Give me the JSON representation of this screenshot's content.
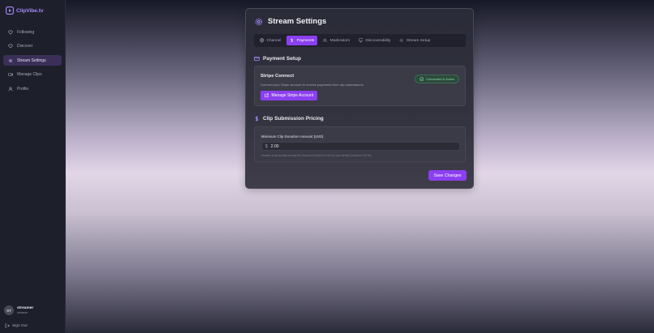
{
  "app": {
    "name": "ClipVibe.tv"
  },
  "sidebar": {
    "items": [
      {
        "label": "Following",
        "icon": "heart-icon"
      },
      {
        "label": "Discover",
        "icon": "heart-icon"
      },
      {
        "label": "Stream Settings",
        "icon": "gear-icon",
        "active": true
      },
      {
        "label": "Manage Clips",
        "icon": "video-icon"
      },
      {
        "label": "Profile",
        "icon": "user-icon"
      }
    ],
    "user": {
      "initials": "ST",
      "name": "streamer",
      "role": "streamer"
    },
    "signout_label": "Sign Out"
  },
  "settings": {
    "title": "Stream Settings",
    "tabs": [
      {
        "label": "Channel",
        "icon": "globe-icon"
      },
      {
        "label": "Payments",
        "icon": "dollar-icon",
        "active": true
      },
      {
        "label": "Moderators",
        "icon": "users-icon"
      },
      {
        "label": "Discoverability",
        "icon": "monitor-icon"
      },
      {
        "label": "Stream Setup",
        "icon": "gear-icon"
      }
    ],
    "payment_setup": {
      "title": "Payment Setup",
      "stripe_title": "Stripe Connect",
      "stripe_desc": "Connect your Stripe account to receive payments from clip submissions",
      "status": "Connected & Active",
      "manage_button": "Manage Stripe Account"
    },
    "pricing": {
      "title": "Clip Submission Pricing",
      "field_label": "Minimum Clip Donation Amount (USD)",
      "currency_symbol": "$",
      "value": "2.00",
      "help": "Viewers must donate at least this amount to submit a clip for your stream (minimum $0.50)"
    },
    "save_button": "Save Changes"
  },
  "colors": {
    "accent": "#8b3ff0",
    "success": "#7fe0a7",
    "logo": "#a78bfa"
  }
}
